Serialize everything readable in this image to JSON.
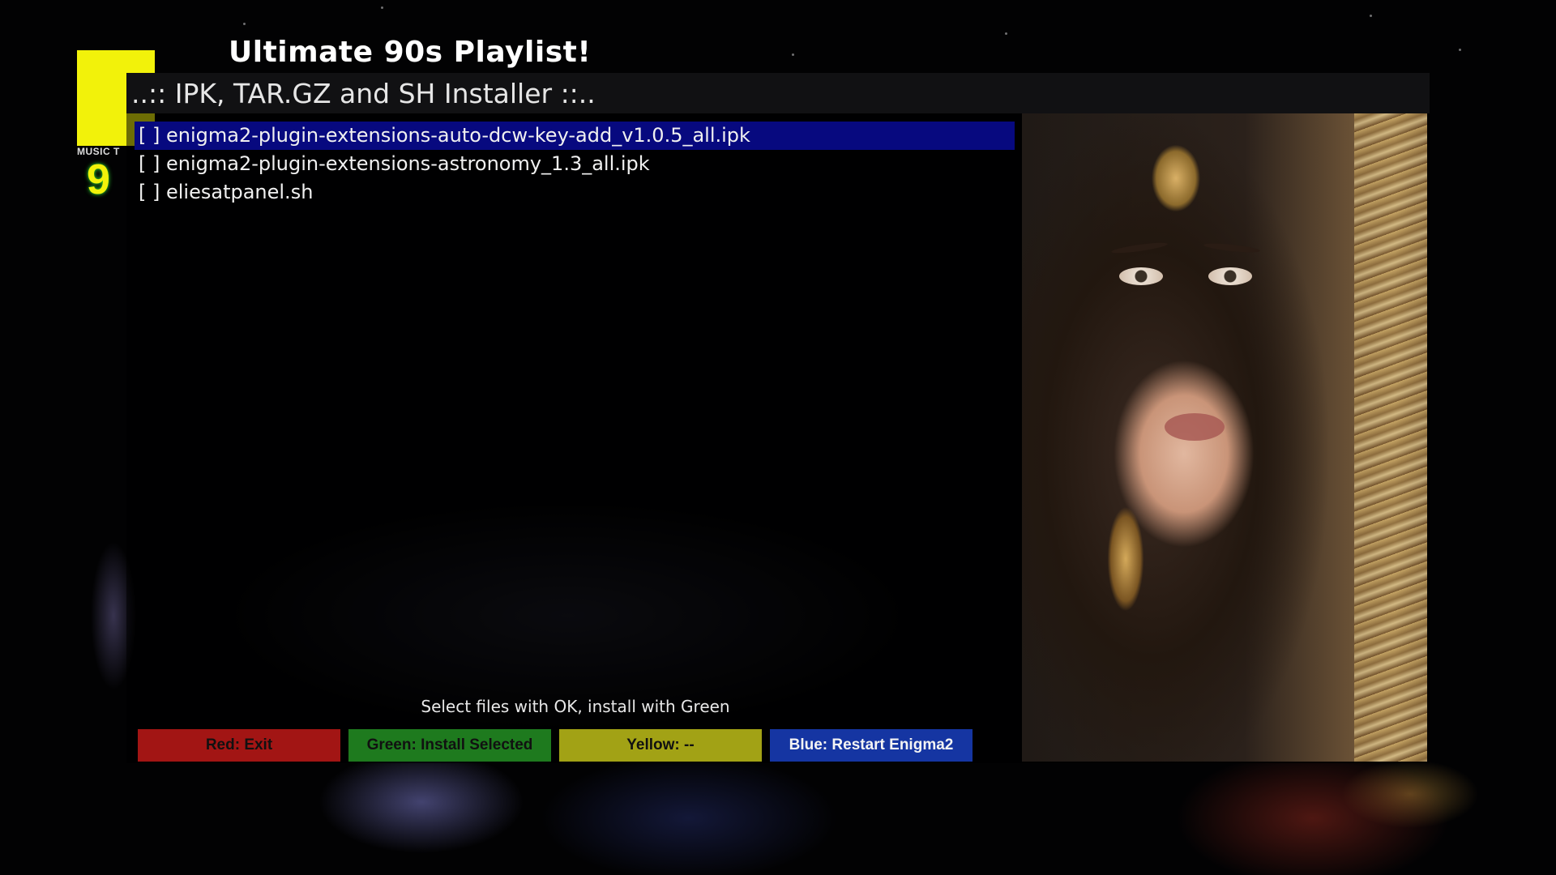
{
  "background": {
    "playlist_title": "Ultimate 90s Playlist!",
    "logo": {
      "music_text": "MUSIC T",
      "number_text": "9",
      "colors": {
        "yellow": "#f2f20a",
        "green_glow": "#33cc33"
      }
    }
  },
  "window": {
    "title": "..:: IPK, TAR.GZ and SH Installer ::..",
    "files": [
      {
        "label": "[ ] enigma2-plugin-extensions-auto-dcw-key-add_v1.0.5_all.ipk",
        "selected": true
      },
      {
        "label": "[ ] enigma2-plugin-extensions-astronomy_1.3_all.ipk",
        "selected": false
      },
      {
        "label": "[ ] eliesatpanel.sh",
        "selected": false
      }
    ],
    "hint": "Select files with OK, install with Green",
    "buttons": {
      "red": "Red: Exit",
      "green": "Green: Install Selected",
      "yellow": "Yellow: --",
      "blue": "Blue: Restart Enigma2"
    },
    "colors": {
      "selection": "#07097f",
      "red": "#a21514",
      "green": "#1e7a1e",
      "yellow": "#a2a215",
      "blue": "#1535a2"
    }
  }
}
